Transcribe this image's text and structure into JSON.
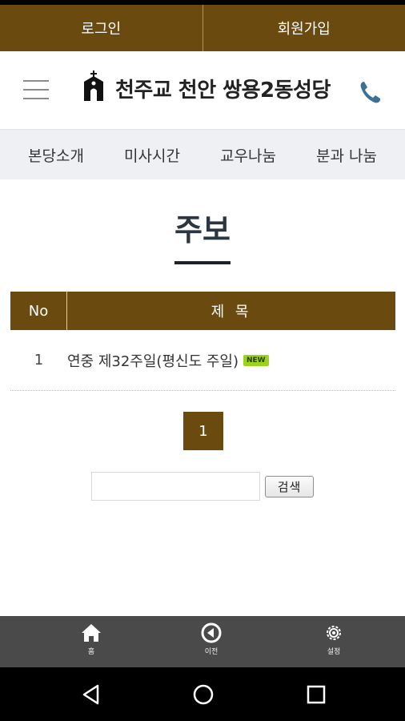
{
  "topbar": {
    "login": "로그인",
    "signup": "회원가입"
  },
  "header": {
    "site_title": "천주교 천안 쌍용2동성당",
    "menu_icon": "hamburger-menu-icon",
    "logo_icon": "church-logo-icon",
    "phone_icon": "phone-icon"
  },
  "nav": {
    "items": [
      "본당소개",
      "미사시간",
      "교우나눔",
      "분과 나눔"
    ]
  },
  "page": {
    "title": "주보"
  },
  "board": {
    "headers": {
      "no": "No",
      "title": "제 목"
    },
    "rows": [
      {
        "no": "1",
        "title": "연중 제32주일(평신도 주일)",
        "badge": "NEW"
      }
    ]
  },
  "pagination": {
    "current": "1"
  },
  "search": {
    "value": "",
    "placeholder": "",
    "button": "검색"
  },
  "bottom_bar": {
    "home": "홈",
    "back": "이전",
    "settings": "설정"
  },
  "colors": {
    "brand_brown": "#6b4a10",
    "nav_bg": "#eef0f3",
    "new_badge": "#9bd31a",
    "bottom_bar": "#4a4a4a"
  }
}
